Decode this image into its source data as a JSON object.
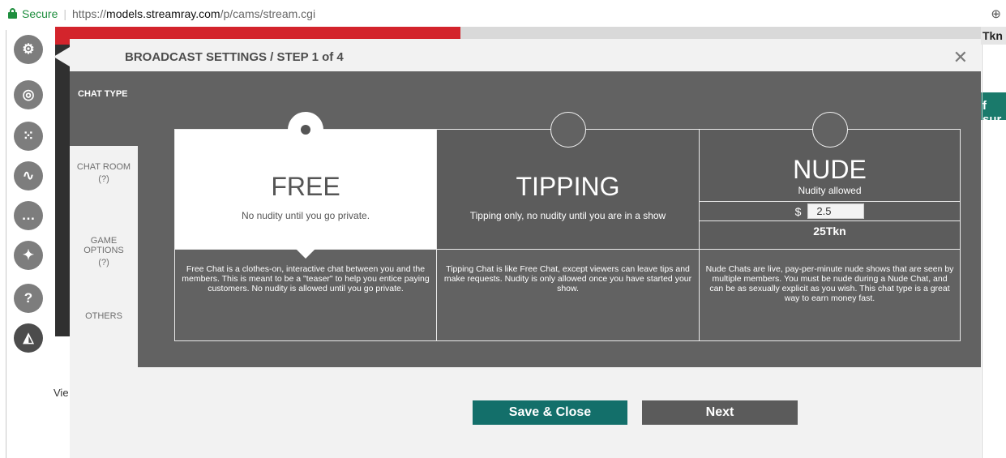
{
  "browser": {
    "secure_label": "Secure",
    "url_protocol": "https://",
    "url_host": "models.streamray.com",
    "url_path": "/p/cams/stream.cgi",
    "zoom_icon": "⊕"
  },
  "rail": {
    "icons": [
      {
        "name": "settings-gear-icon",
        "glyph": "⚙"
      },
      {
        "name": "target-icon",
        "glyph": "◎"
      },
      {
        "name": "dice-icon",
        "glyph": "⁙"
      },
      {
        "name": "stats-line-icon",
        "glyph": "∿"
      },
      {
        "name": "chat-bubble-icon",
        "glyph": "…"
      },
      {
        "name": "twitter-icon",
        "glyph": "✦"
      },
      {
        "name": "help-icon",
        "glyph": "?"
      },
      {
        "name": "broadcast-icon",
        "glyph": "◭"
      }
    ]
  },
  "background": {
    "tkn_fragment": "Tkn",
    "banner_fragment": "f sur",
    "vie_fragment": "Vie"
  },
  "modal": {
    "title": "BROADCAST SETTINGS / STEP 1 of 4",
    "close_icon": "✕",
    "chat_type_label": "CHAT TYPE",
    "sidenav": [
      {
        "label": "CHAT ROOM",
        "help": "?"
      },
      {
        "label": "GAME OPTIONS",
        "help": "?"
      },
      {
        "label": "OTHERS"
      }
    ],
    "cards": {
      "free": {
        "title": "FREE",
        "subtitle": "No nudity until you go private.",
        "description": "Free Chat is a clothes-on, interactive chat between you and the members. This is meant to be a \"teaser\" to help you entice paying customers. No nudity is allowed until you go private.",
        "selected": true
      },
      "tipping": {
        "title": "TIPPING",
        "subtitle": "Tipping only, no nudity until you are in a show",
        "description": "Tipping Chat is like Free Chat, except viewers can leave tips and make requests. Nudity is only allowed once you have started your show.",
        "selected": false
      },
      "nude": {
        "title": "NUDE",
        "subtitle": "Nudity allowed",
        "currency_symbol": "$",
        "price_value": "2.5",
        "tokens": "25Tkn",
        "description": "Nude Chats are live, pay-per-minute nude shows that are seen by multiple members. You must be nude during a Nude Chat, and can be as sexually explicit as you wish. This chat type is a great way to earn money fast.",
        "selected": false
      }
    },
    "buttons": {
      "save_close": "Save & Close",
      "next": "Next"
    },
    "colors": {
      "accent_teal": "#136f6a",
      "panel_grey": "#626262",
      "modal_bg": "#f2f2f2"
    }
  }
}
